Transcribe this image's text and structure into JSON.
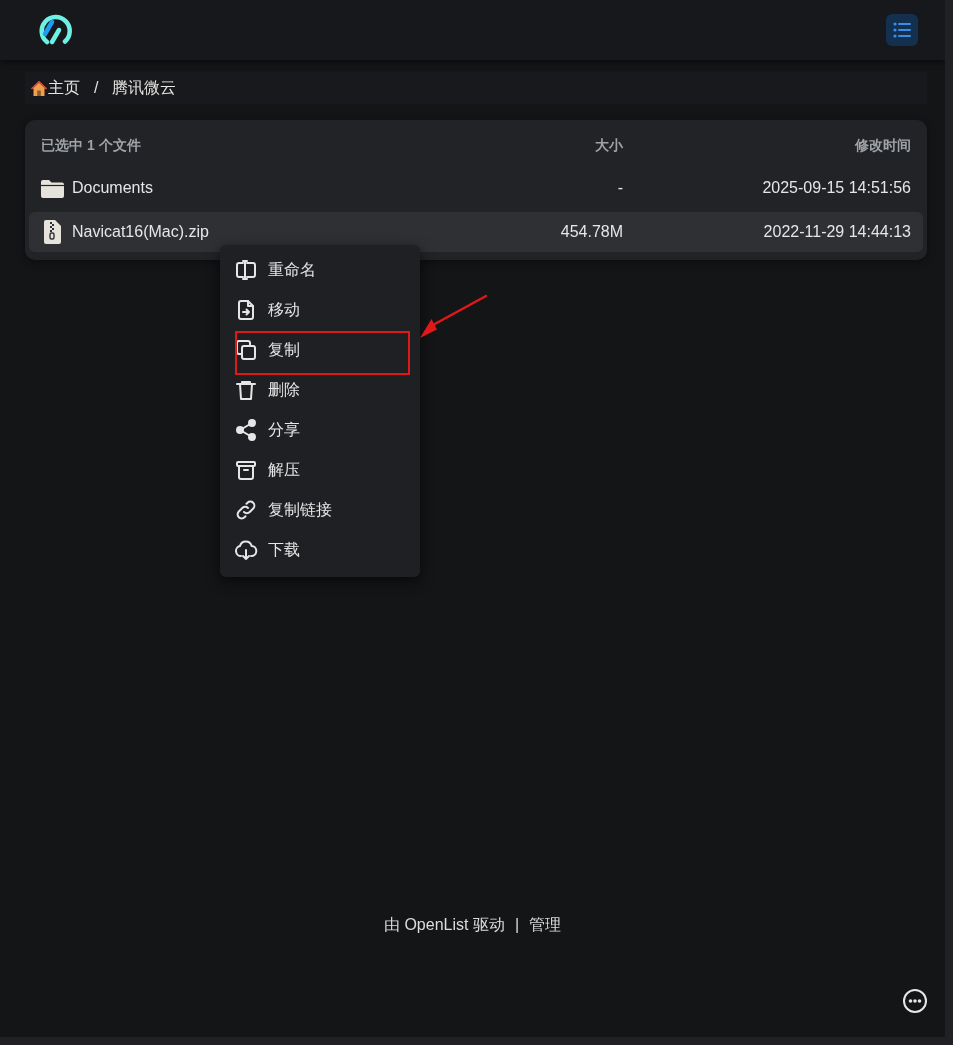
{
  "breadcrumb": {
    "items": [
      {
        "label": "主页",
        "kind": "home"
      },
      {
        "label": "腾讯微云",
        "kind": "folder"
      }
    ],
    "separator": "/"
  },
  "file_list": {
    "columns": [
      "已选中 1 个文件",
      "大小",
      "修改时间"
    ],
    "rows": [
      {
        "name": "Documents",
        "kind": "folder",
        "size": "-",
        "modified": "2025-09-15 14:51:56",
        "selected": false
      },
      {
        "name": "Navicat16(Mac).zip",
        "kind": "zip",
        "size": "454.78M",
        "modified": "2022-11-29 14:44:13",
        "selected": true
      }
    ]
  },
  "context_menu": {
    "items": [
      {
        "label": "重命名",
        "kind": "rename",
        "highlighted": false
      },
      {
        "label": "移动",
        "kind": "move",
        "highlighted": false
      },
      {
        "label": "复制",
        "kind": "copy",
        "highlighted": true
      },
      {
        "label": "删除",
        "kind": "delete",
        "highlighted": false
      },
      {
        "label": "分享",
        "kind": "share",
        "highlighted": false
      },
      {
        "label": "解压",
        "kind": "extract",
        "highlighted": false
      },
      {
        "label": "复制链接",
        "kind": "copy-link",
        "highlighted": false
      },
      {
        "label": "下载",
        "kind": "download",
        "highlighted": false
      }
    ]
  },
  "footer": {
    "powered_by": "由 OpenList 驱动",
    "separator": "|",
    "admin_link": "管理"
  }
}
